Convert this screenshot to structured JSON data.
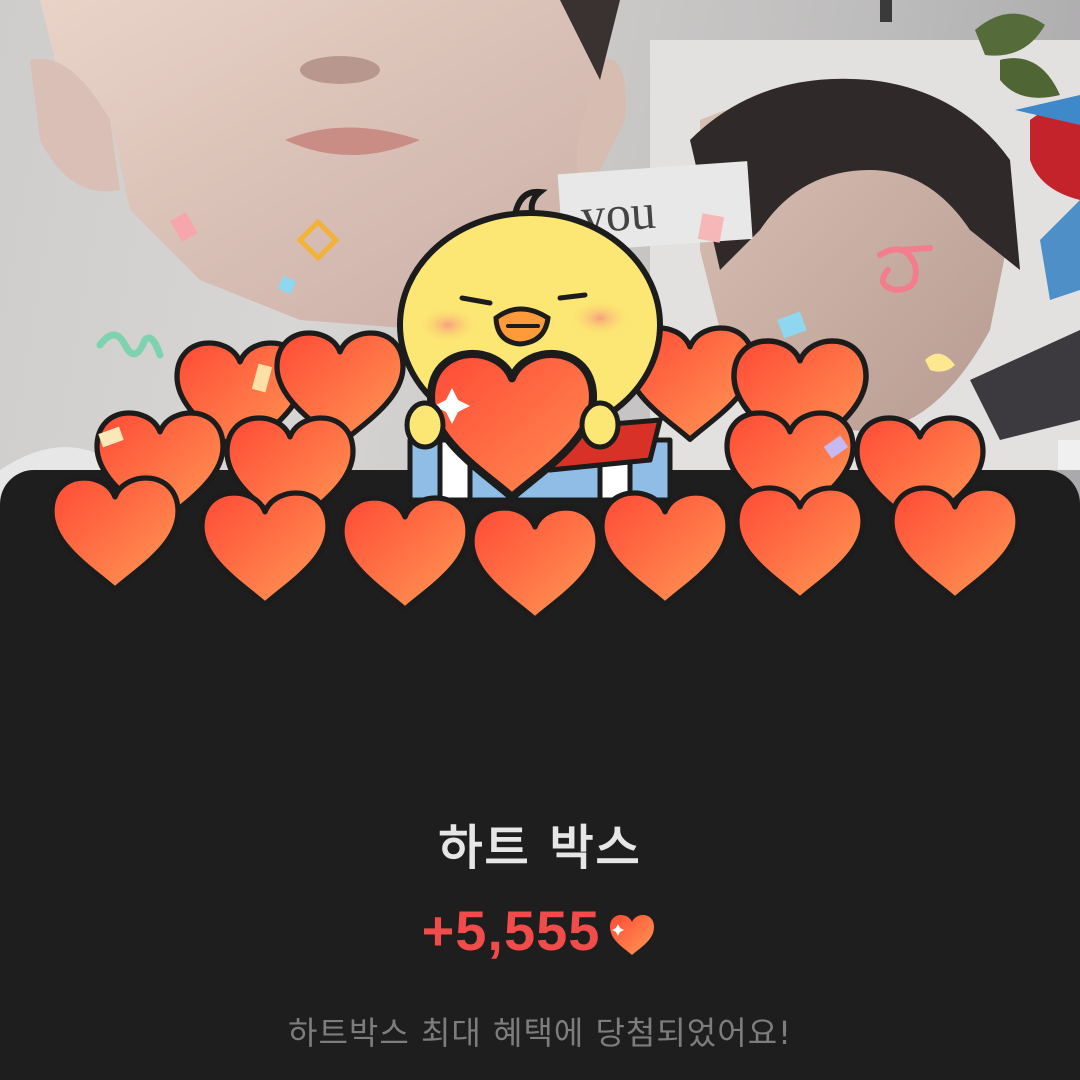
{
  "photo": {
    "note_text": "you",
    "description_icon": "photo-collage-background"
  },
  "illustration": {
    "icon": "chick-holding-heart-in-gift-box-with-hearts-icon"
  },
  "reward": {
    "title": "하트 박스",
    "amount": "+5,555",
    "amount_icon": "heart-icon",
    "description": "하트박스 최대 혜택에 당첨되었어요!"
  },
  "colors": {
    "sheet_background": "#1e1e1e",
    "amount": "#f04c4c",
    "title": "#e6e6e6",
    "description": "#7d7d7d",
    "heart": "#ff5a3c"
  }
}
